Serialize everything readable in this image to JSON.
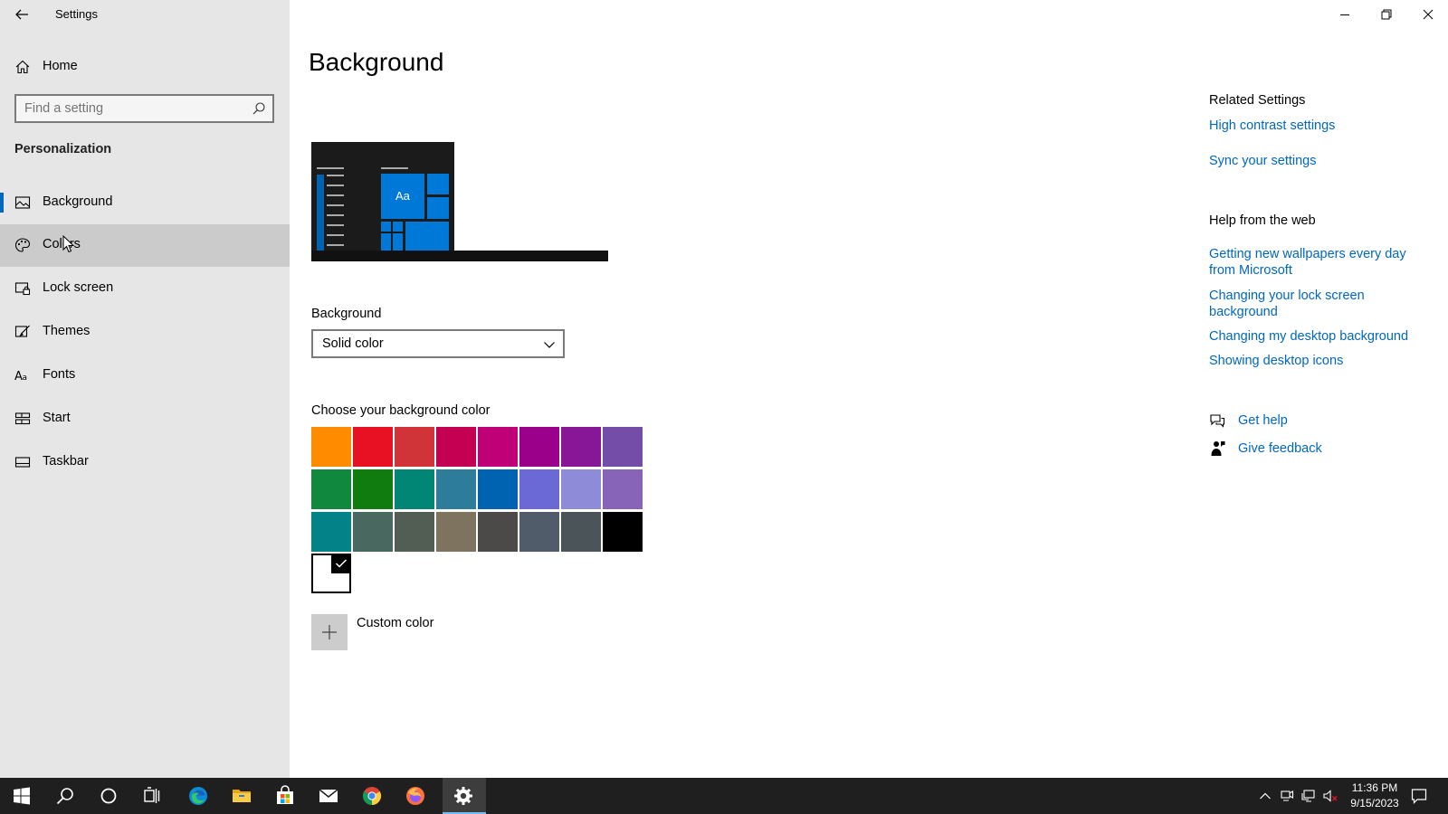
{
  "window": {
    "title": "Settings",
    "controls": [
      "minimize-icon",
      "restore-icon",
      "close-icon"
    ]
  },
  "sidebar": {
    "home_label": "Home",
    "search_placeholder": "Find a setting",
    "section_title": "Personalization",
    "items": [
      {
        "label": "Background",
        "icon": "image-icon",
        "selected": true
      },
      {
        "label": "Colors",
        "icon": "palette-icon",
        "hover": true
      },
      {
        "label": "Lock screen",
        "icon": "lock-screen-icon"
      },
      {
        "label": "Themes",
        "icon": "brush-icon"
      },
      {
        "label": "Fonts",
        "icon": "font-icon"
      },
      {
        "label": "Start",
        "icon": "start-icon"
      },
      {
        "label": "Taskbar",
        "icon": "taskbar-icon"
      }
    ]
  },
  "main": {
    "title": "Background",
    "preview_tile_text": "Aa",
    "background_label": "Background",
    "background_value": "Solid color",
    "choose_color_label": "Choose your background color",
    "swatch_colors": [
      [
        "#FF8C00",
        "#E81123",
        "#D13438",
        "#C30052",
        "#BF0077",
        "#9A0089",
        "#881798",
        "#744DA9"
      ],
      [
        "#10893E",
        "#107C10",
        "#018574",
        "#2D7D9A",
        "#0063B1",
        "#6B69D6",
        "#8E8CD8",
        "#8764B8"
      ],
      [
        "#038387",
        "#486860",
        "#525E54",
        "#7E735F",
        "#4C4A48",
        "#515C6B",
        "#4A5459",
        "#000000"
      ]
    ],
    "selected_color": "#FFFFFF",
    "custom_color_label": "Custom color"
  },
  "related": {
    "title": "Related Settings",
    "links": [
      "High contrast settings",
      "Sync your settings"
    ]
  },
  "help": {
    "title": "Help from the web",
    "links": [
      "Getting new wallpapers every day from Microsoft",
      "Changing your lock screen background",
      "Changing my desktop background",
      "Showing desktop icons"
    ],
    "get_help": "Get help",
    "give_feedback": "Give feedback"
  },
  "taskbar": {
    "apps": [
      "windows-start-icon",
      "search-icon",
      "cortana-icon",
      "task-view-icon",
      "edge-icon",
      "file-explorer-icon",
      "store-icon",
      "mail-icon",
      "chrome-icon",
      "firefox-icon",
      "settings-icon"
    ],
    "active_app": "settings-icon",
    "time": "11:36 PM",
    "date": "9/15/2023"
  },
  "colors": {
    "accent": "#0067c0",
    "sidebar_bg": "#e6e6e6",
    "taskbar_bg": "#1f1f1f"
  }
}
